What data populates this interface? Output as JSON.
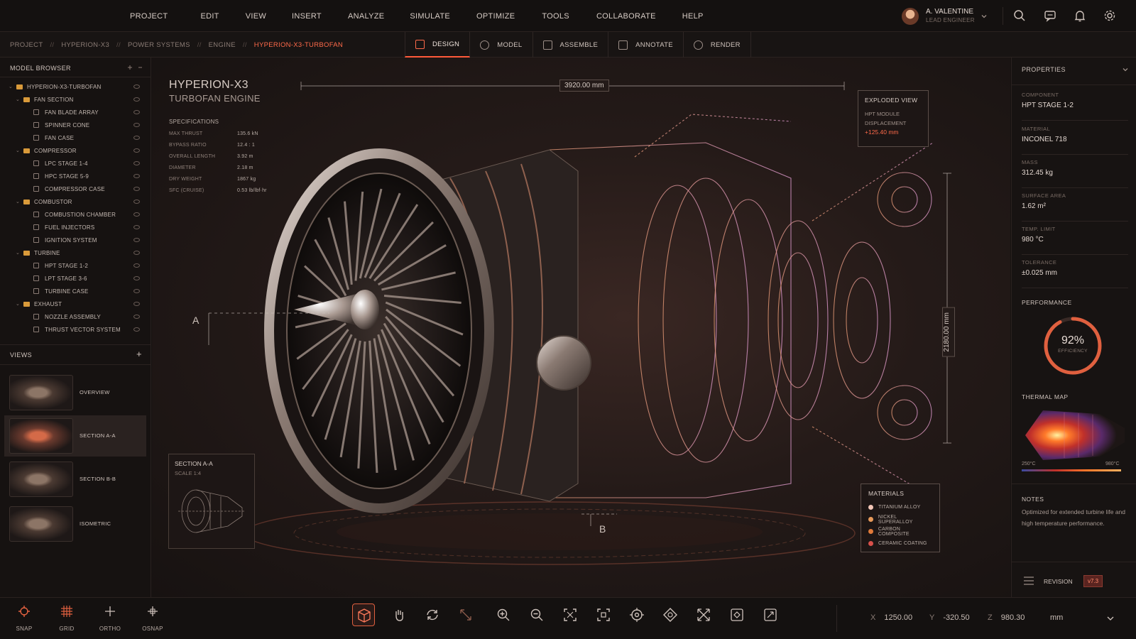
{
  "menu": [
    "PROJECT",
    "EDIT",
    "VIEW",
    "INSERT",
    "ANALYZE",
    "SIMULATE",
    "OPTIMIZE",
    "TOOLS",
    "COLLABORATE",
    "HELP"
  ],
  "user": {
    "name": "A. VALENTINE",
    "role": "LEAD ENGINEER"
  },
  "breadcrumb": [
    "PROJECT",
    "HYPERION-X3",
    "POWER SYSTEMS",
    "ENGINE",
    "HYPERION-X3-TURBOFAN"
  ],
  "breadcrumb_sep": "//",
  "mode_tabs": [
    "DESIGN",
    "MODEL",
    "ASSEMBLE",
    "ANNOTATE",
    "RENDER"
  ],
  "model_browser": {
    "title": "MODEL BROWSER",
    "tree": [
      {
        "label": "HYPERION-X3-TURBOFAN",
        "kind": "folder",
        "depth": 0
      },
      {
        "label": "FAN SECTION",
        "kind": "folder",
        "depth": 1
      },
      {
        "label": "FAN BLADE ARRAY",
        "kind": "file",
        "depth": 2
      },
      {
        "label": "SPINNER CONE",
        "kind": "file",
        "depth": 2
      },
      {
        "label": "FAN CASE",
        "kind": "file",
        "depth": 2
      },
      {
        "label": "COMPRESSOR",
        "kind": "folder",
        "depth": 1
      },
      {
        "label": "LPC STAGE 1-4",
        "kind": "file",
        "depth": 2
      },
      {
        "label": "HPC STAGE 5-9",
        "kind": "file",
        "depth": 2
      },
      {
        "label": "COMPRESSOR CASE",
        "kind": "file",
        "depth": 2
      },
      {
        "label": "COMBUSTOR",
        "kind": "folder",
        "depth": 1
      },
      {
        "label": "COMBUSTION CHAMBER",
        "kind": "file",
        "depth": 2
      },
      {
        "label": "FUEL INJECTORS",
        "kind": "file",
        "depth": 2
      },
      {
        "label": "IGNITION SYSTEM",
        "kind": "file",
        "depth": 2
      },
      {
        "label": "TURBINE",
        "kind": "folder",
        "depth": 1
      },
      {
        "label": "HPT STAGE 1-2",
        "kind": "file",
        "depth": 2
      },
      {
        "label": "LPT STAGE 3-6",
        "kind": "file",
        "depth": 2
      },
      {
        "label": "TURBINE CASE",
        "kind": "file",
        "depth": 2
      },
      {
        "label": "EXHAUST",
        "kind": "folder",
        "depth": 1
      },
      {
        "label": "NOZZLE ASSEMBLY",
        "kind": "file",
        "depth": 2
      },
      {
        "label": "THRUST VECTOR SYSTEM",
        "kind": "file",
        "depth": 2
      }
    ]
  },
  "views": {
    "title": "VIEWS",
    "add": "+",
    "items": [
      "OVERVIEW",
      "SECTION A-A",
      "SECTION B-B",
      "ISOMETRIC"
    ],
    "selected": 1
  },
  "viewport": {
    "title1": "HYPERION-X3",
    "title2": "TURBOFAN ENGINE",
    "spec_title": "SPECIFICATIONS",
    "specs": [
      {
        "k": "MAX THRUST",
        "v": "135.6 kN"
      },
      {
        "k": "BYPASS RATIO",
        "v": "12.4 : 1"
      },
      {
        "k": "OVERALL LENGTH",
        "v": "3.92 m"
      },
      {
        "k": "DIAMETER",
        "v": "2.18 m"
      },
      {
        "k": "DRY WEIGHT",
        "v": "1867 kg"
      },
      {
        "k": "SFC (CRUISE)",
        "v": "0.53 lb/lbf·hr"
      }
    ],
    "dim_length": "3920.00 mm",
    "dim_height": "2180.00 mm",
    "marker_a": "A",
    "marker_b": "B",
    "exploded": {
      "title": "EXPLODED VIEW",
      "l1": "HPT MODULE",
      "l2": "DISPLACEMENT",
      "value": "+125.40 mm"
    },
    "section": {
      "title": "SECTION A-A",
      "scale": "SCALE 1:4"
    },
    "materials": {
      "title": "MATERIALS",
      "items": [
        {
          "name": "TITANIUM ALLOY",
          "color": "#f3c7b8"
        },
        {
          "name": "NICKEL SUPERALLOY",
          "color": "#e89a5a"
        },
        {
          "name": "CARBON COMPOSITE",
          "color": "#e07a3a"
        },
        {
          "name": "CERAMIC COATING",
          "color": "#d8504a"
        }
      ]
    }
  },
  "properties": {
    "title": "PROPERTIES",
    "items": [
      {
        "label": "COMPONENT",
        "value": "HPT STAGE 1-2"
      },
      {
        "label": "MATERIAL",
        "value": "INCONEL 718"
      },
      {
        "label": "MASS",
        "value": "312.45 kg"
      },
      {
        "label": "SURFACE AREA",
        "value": "1.62 m²"
      },
      {
        "label": "TEMP. LIMIT",
        "value": "980 °C"
      },
      {
        "label": "TOLERANCE",
        "value": "±0.025 mm"
      }
    ],
    "performance_title": "PERFORMANCE",
    "efficiency": 92,
    "efficiency_text": "92%",
    "efficiency_label": "EFFICIENCY",
    "thermal_title": "THERMAL MAP",
    "thermal_min": "250°C",
    "thermal_max": "980°C",
    "notes_title": "NOTES",
    "notes_text": "Optimized for extended turbine life and high temperature performance.",
    "revision_label": "REVISION",
    "revision_value": "v7.3"
  },
  "bottom_tools": [
    "SNAP",
    "GRID",
    "ORTHO",
    "OSNAP"
  ],
  "coords": {
    "x_label": "X",
    "x": "1250.00",
    "y_label": "Y",
    "y": "-320.50",
    "z_label": "Z",
    "z": "980.30",
    "unit": "mm"
  },
  "colors": {
    "accent": "#ff5a3a",
    "accent_soft": "#ff8a6a",
    "folder": "#d99a3a",
    "bg": "#161211"
  }
}
